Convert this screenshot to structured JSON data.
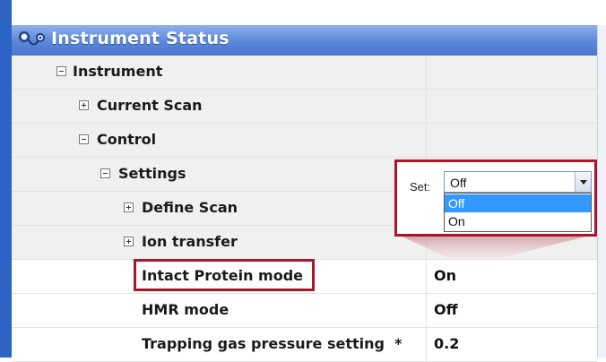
{
  "window": {
    "title": "Instrument Status",
    "icon": "stethoscope-icon"
  },
  "tree": [
    {
      "label": "Instrument",
      "expander": "minus",
      "value": ""
    },
    {
      "label": "Current Scan",
      "expander": "plus",
      "value": ""
    },
    {
      "label": "Control",
      "expander": "minus",
      "value": ""
    },
    {
      "label": "Settings",
      "expander": "minus",
      "value": ""
    },
    {
      "label": "Define Scan",
      "expander": "plus",
      "value": ""
    },
    {
      "label": "Ion transfer",
      "expander": "plus",
      "value": ""
    },
    {
      "label": "Intact Protein mode",
      "expander": "none",
      "value": "On"
    },
    {
      "label": "HMR mode",
      "expander": "none",
      "value": "Off"
    },
    {
      "label": "Trapping gas pressure setting  *",
      "expander": "none",
      "value": "0.2"
    }
  ],
  "setter": {
    "label": "Set:",
    "current": "Off",
    "options": [
      "Off",
      "On"
    ],
    "highlighted": "Off"
  },
  "colors": {
    "accent": "#a8182b",
    "titlebar": "#5a87d9",
    "selection": "#3399ff"
  }
}
